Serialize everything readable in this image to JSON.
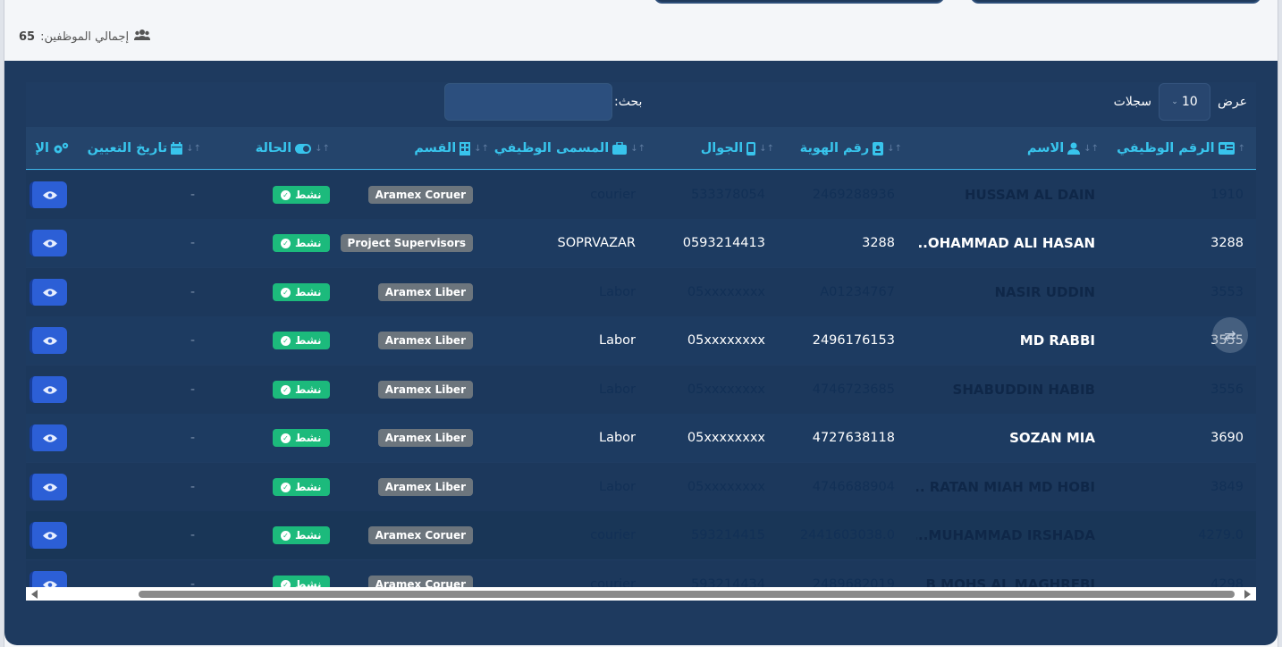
{
  "header": {
    "total_label": "إجمالي الموظفين:",
    "total_count": "65",
    "total_icon": "users-icon"
  },
  "controls": {
    "length_prefix": "عرض",
    "length_value": "10",
    "length_suffix": "سجلات",
    "search_label": "بحث:",
    "search_value": ""
  },
  "columns": {
    "emp_no": "الرقم الوظيفي",
    "name": "الاسم",
    "id_no": "رقم الهوية",
    "mobile": "الجوال",
    "job_title": "المسمى الوظيفي",
    "department": "القسم",
    "status": "الحالة",
    "assign_date": "تاريخ التعيين",
    "actions": "الإ"
  },
  "rows": [
    {
      "emp_no": "1910",
      "name": "HUSSAM AL DAIN",
      "id_no": "2469288936",
      "mobile": "533378054",
      "job_title": "courier",
      "department": "Aramex Coruer",
      "status": "نشط",
      "assign_date": "-"
    },
    {
      "emp_no": "3288",
      "name": "...OHAMMAD ALI HASAN",
      "id_no": "3288",
      "mobile": "0593214413",
      "job_title": "SOPRVAZAR",
      "department": "Project Supervisors",
      "status": "نشط",
      "assign_date": "-"
    },
    {
      "emp_no": "3553",
      "name": "NASIR UDDIN",
      "id_no": "A01234767",
      "mobile": "05xxxxxxxx",
      "job_title": "Labor",
      "department": "Aramex Liber",
      "status": "نشط",
      "assign_date": "-"
    },
    {
      "emp_no": "3555",
      "name": "MD RABBI",
      "id_no": "2496176153",
      "mobile": "05xxxxxxxx",
      "job_title": "Labor",
      "department": "Aramex Liber",
      "status": "نشط",
      "assign_date": "-"
    },
    {
      "emp_no": "3556",
      "name": "SHABUDDIN HABIB",
      "id_no": "4746723685",
      "mobile": "05xxxxxxxx",
      "job_title": "Labor",
      "department": "Aramex Liber",
      "status": "نشط",
      "assign_date": "-"
    },
    {
      "emp_no": "3690",
      "name": "SOZAN MIA",
      "id_no": "4727638118",
      "mobile": "05xxxxxxxx",
      "job_title": "Labor",
      "department": "Aramex Liber",
      "status": "نشط",
      "assign_date": "-"
    },
    {
      "emp_no": "3849",
      "name": "... RATAN MIAH MD HOBI",
      "id_no": "4746688904",
      "mobile": "05xxxxxxxx",
      "job_title": "Labor",
      "department": "Aramex Liber",
      "status": "نشط",
      "assign_date": "-"
    },
    {
      "emp_no": "4279.0",
      "name": "...MUHAMMAD IRSHADA",
      "id_no": "2441603038.0",
      "mobile": "593214415",
      "job_title": "courier",
      "department": "Aramex Coruer",
      "status": "نشط",
      "assign_date": "-"
    },
    {
      "emp_no": "4298",
      "name": "B MOHS AL MAGHREBI",
      "id_no": "2489682019",
      "mobile": "593214434",
      "job_title": "courier",
      "department": "Aramex Coruer",
      "status": "نشط",
      "assign_date": "-"
    }
  ]
}
